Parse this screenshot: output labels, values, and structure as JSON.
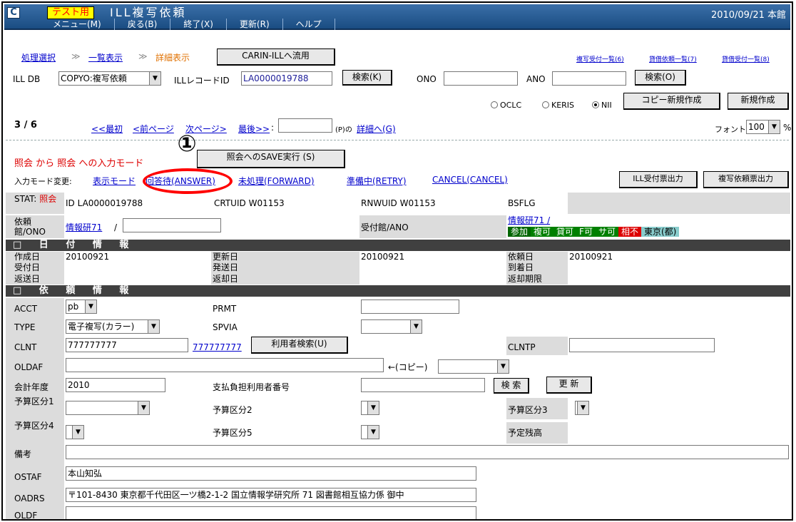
{
  "window": {
    "test_badge": "テスト用",
    "title": "ILL複写依頼",
    "date_library": "2010/09/21 本館"
  },
  "menu": {
    "items": [
      "メニュー(M)",
      "戻る(B)",
      "終了(X)",
      "更新(R)",
      "ヘルプ"
    ]
  },
  "breadcrumb": {
    "items": [
      "処理選択",
      "一覧表示",
      "詳細表示"
    ],
    "separator": "≫",
    "carin_button": "CARIN-ILLへ流用"
  },
  "toplinks": [
    "複写受付一覧(6)",
    "貸借依頼一覧(7)",
    "貸借受付一覧(8)"
  ],
  "search": {
    "ill_db_label": "ILL DB",
    "ill_db_value": "COPYO:複写依頼",
    "record_id_label": "ILLレコードID",
    "record_id_value": "LA0000019788",
    "search_k": "検索(K)",
    "ono_label": "ONO",
    "ano_label": "ANO",
    "search_o": "検索(O)"
  },
  "radios": {
    "options": [
      "OCLC",
      "KERIS",
      "NII"
    ],
    "selected": "NII"
  },
  "actions": {
    "copy_new": "コピー新規作成",
    "new": "新規作成"
  },
  "pager": {
    "position": "3 / 6",
    "first": "<<最初",
    "prev": "<前ページ",
    "next": "次ページ>",
    "last": "最後>>",
    "colon": ":",
    "suffix": "(P)の",
    "detail": "詳細へ(G)",
    "font_label": "フォント",
    "font_value": "100",
    "percent": "%"
  },
  "mode": {
    "title": "照会 から 照会 への入力モード",
    "save_button": "照会へのSAVE実行 (S)",
    "change_label": "入力モード変更:",
    "links": [
      "表示モード",
      "回答待(ANSWER)",
      "未処理(FORWARD)",
      "準備中(RETRY)",
      "CANCEL(CANCEL)"
    ],
    "marker": "①",
    "ill_receipt": "ILL受付票出力",
    "copy_request": "複写依頼票出力"
  },
  "status": {
    "stat_label": "STAT:",
    "stat_value": "照会",
    "id_label": "ID",
    "id_value": "LA0000019788",
    "crtuid_label": "CRTUID",
    "crtuid_value": "W01153",
    "rnwuid_label": "RNWUID",
    "rnwuid_value": "W01153",
    "bsflg_label": "BSFLG",
    "req_lib_label": "依頼館/ONO",
    "req_lib_value": "情報研71",
    "slash": "/",
    "rcv_lib_label": "受付館/ANO",
    "rcv_lib_value": "情報研71 /",
    "tags": [
      {
        "text": "参加",
        "color": "#006600"
      },
      {
        "text": "複可",
        "color": "#008000"
      },
      {
        "text": "貸可",
        "color": "#008000"
      },
      {
        "text": "F可",
        "color": "#008000"
      },
      {
        "text": "サ可",
        "color": "#008000"
      },
      {
        "text": "相不",
        "color": "#dd0000"
      },
      {
        "text": "東京(都)",
        "color": "#88cccc"
      }
    ]
  },
  "dates": {
    "section_title": "□ 日 付 情 報",
    "created_label": "作成日",
    "created_value": "20100921",
    "updated_label": "更新日",
    "updated_value": "20100921",
    "requested_label": "依頼日",
    "requested_value": "20100921",
    "received_label": "受付日",
    "sent_label": "発送日",
    "arrived_label": "到着日",
    "returned_label": "返送日",
    "return_label": "返却日",
    "return_due_label": "返却期限"
  },
  "request": {
    "section_title": "□ 依 頼 情 報",
    "acct_label": "ACCT",
    "acct_value": "pb",
    "prmt_label": "PRMT",
    "type_label": "TYPE",
    "type_value": "電子複写(カラー)",
    "spvia_label": "SPVIA",
    "clnt_label": "CLNT",
    "clnt_value": "777777777",
    "clnt_link": "777777777",
    "user_search": "利用者検索(U)",
    "clntp_label": "CLNTP",
    "oldaf_label": "OLDAF",
    "copy_label": "←(コピー)",
    "fiscal_label": "会計年度",
    "fiscal_value": "2010",
    "payer_label": "支払負担利用者番号",
    "search_btn": "検 索",
    "update_btn": "更 新",
    "budget1_label": "予算区分1",
    "budget2_label": "予算区分2",
    "budget3_label": "予算区分3",
    "budget4_label": "予算区分4",
    "budget5_label": "予算区分5",
    "balance_label": "予定残高",
    "note_label": "備考",
    "ostaf_label": "OSTAF",
    "ostaf_value": "本山知弘",
    "oadrs_label": "OADRS",
    "oadrs_value": "〒101-8430 東京都千代田区一ツ橋2-1-2 国立情報学研究所 71 図書館相互協力係 御中",
    "oldf_label": "OLDF"
  }
}
